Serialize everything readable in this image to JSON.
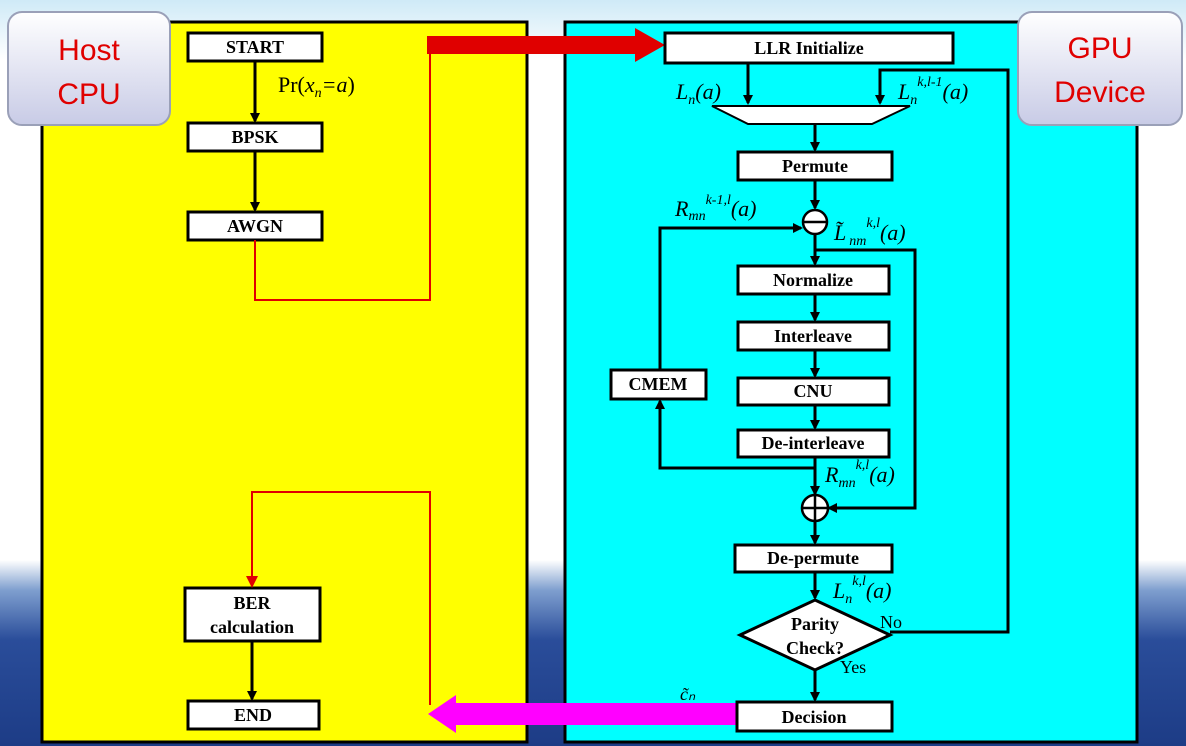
{
  "host_label": {
    "line1": "Host",
    "line2": "CPU"
  },
  "gpu_label": {
    "line1": "GPU",
    "line2": "Device"
  },
  "cpu_blocks": {
    "start": "START",
    "bpsk": "BPSK",
    "awgn": "AWGN",
    "ber_line1": "BER",
    "ber_line2": "calculation",
    "end": "END"
  },
  "cpu_annotations": {
    "pr": "Pr(",
    "x": "x",
    "n": "n",
    "eq_a": "=a",
    "close": ")"
  },
  "gpu_blocks": {
    "llr_init": "LLR Initialize",
    "permute": "Permute",
    "normalize": "Normalize",
    "interleave": "Interleave",
    "cnu": "CNU",
    "deinterleave": "De-interleave",
    "cmem": "CMEM",
    "depermute": "De-permute",
    "parity_line1": "Parity",
    "parity_line2": "Check?",
    "decision": "Decision"
  },
  "gpu_annotations": {
    "ln": "L",
    "ln_sub": "n",
    "a": "(a)",
    "ln_prev_sup": "k,l-1",
    "r_prev": "R",
    "r_sub": "mn",
    "r_prev_sup": "k-1,l",
    "lt": "L̃",
    "lt_sub": "nm",
    "lt_sup": "k,l",
    "r_sup": "k,l",
    "ln_kl_sup": "k,l",
    "no": "No",
    "yes": "Yes",
    "c_hat": "c̃ₙ"
  },
  "colors": {
    "host_panel": "#ffff00",
    "gpu_panel": "#00ffff",
    "transfer_to_gpu": "#ff0000",
    "transfer_to_cpu": "#ff00ff",
    "label_text": "#e00000"
  }
}
